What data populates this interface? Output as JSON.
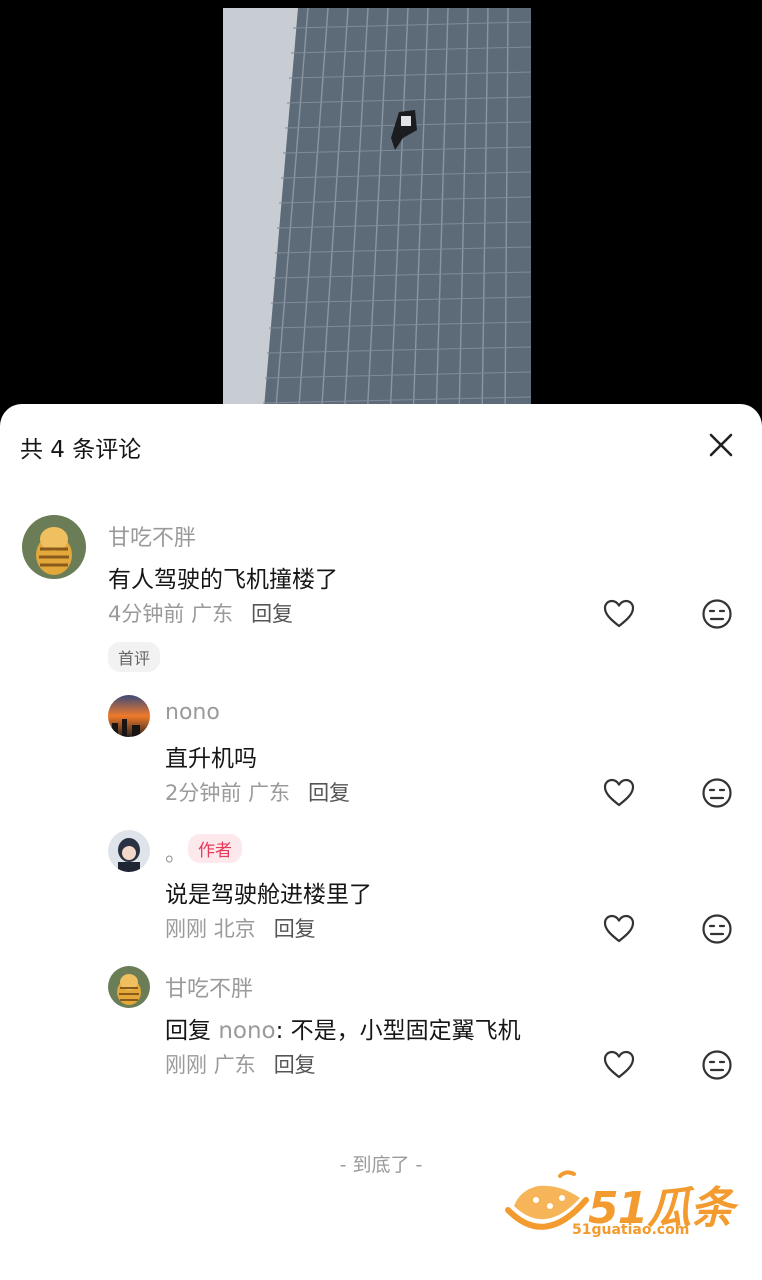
{
  "sheet": {
    "title": "共 4 条评论",
    "end_text": "- 到底了 -"
  },
  "icons": {
    "close": "close-icon",
    "like": "heart-icon",
    "dislike": "meh-face-icon"
  },
  "comments": [
    {
      "name": "甘吃不胖",
      "text": "有人驾驶的飞机撞楼了",
      "time": "4分钟前",
      "location": "广东",
      "reply_label": "回复",
      "tag": "首评"
    },
    {
      "name": "nono",
      "text": "直升机吗",
      "time": "2分钟前",
      "location": "广东",
      "reply_label": "回复"
    },
    {
      "name": "。",
      "author_tag": "作者",
      "text": "说是驾驶舱进楼里了",
      "time": "刚刚",
      "location": "北京",
      "reply_label": "回复"
    },
    {
      "name": "甘吃不胖",
      "reply_prefix": "回复",
      "reply_target": "nono",
      "text": ": 不是，小型固定翼飞机",
      "time": "刚刚",
      "location": "广东",
      "reply_label": "回复"
    }
  ],
  "watermark": {
    "brand": "51瓜条",
    "url": "51guatiao.com"
  },
  "colors": {
    "accent_red": "#e8395a",
    "watermark_orange": "#f39b2e"
  }
}
